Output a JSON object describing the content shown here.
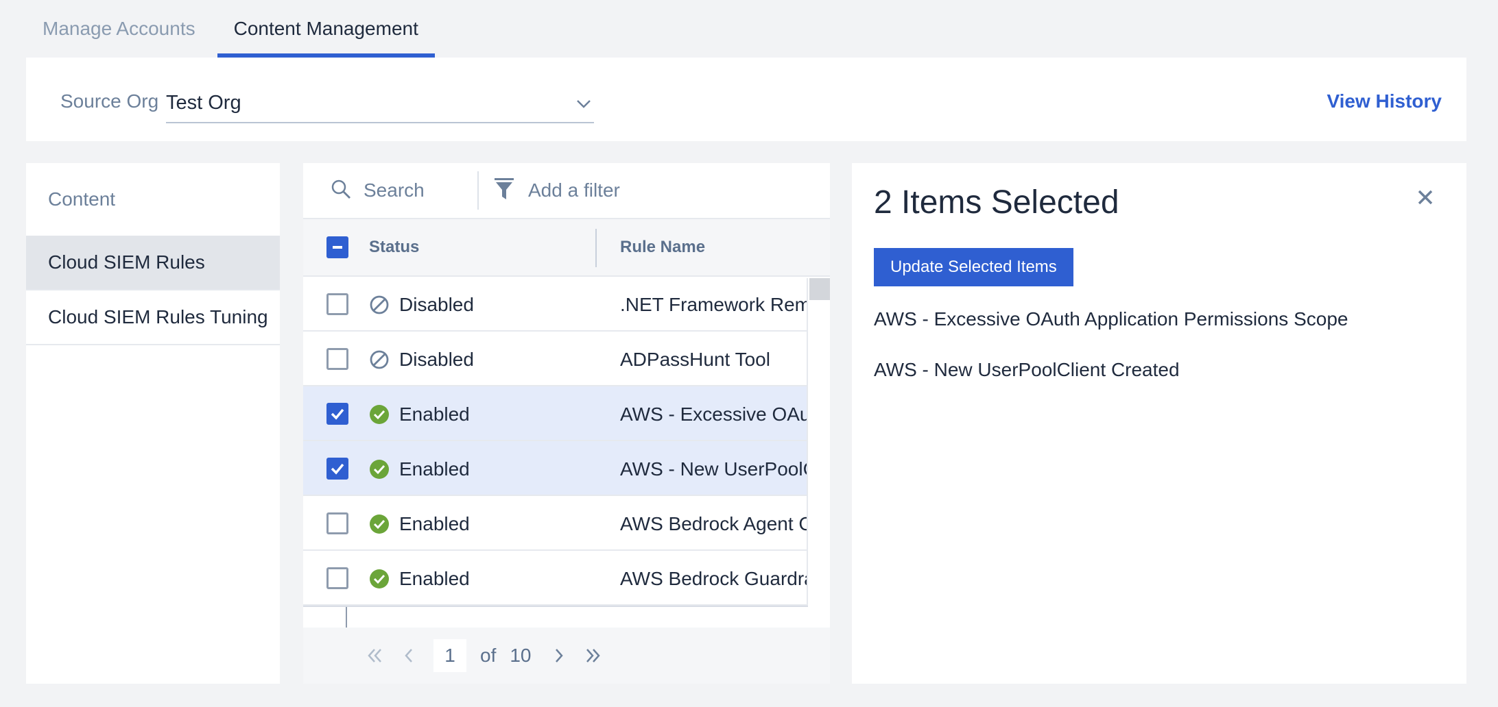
{
  "tabs": [
    {
      "label": "Manage Accounts",
      "active": false
    },
    {
      "label": "Content Management",
      "active": true
    }
  ],
  "org_bar": {
    "label": "Source Org",
    "value": "Test Org",
    "view_history": "View History"
  },
  "left_nav": {
    "heading": "Content",
    "items": [
      {
        "label": "Cloud SIEM Rules",
        "active": true
      },
      {
        "label": "Cloud SIEM Rules Tuning",
        "active": false
      }
    ]
  },
  "table": {
    "search_placeholder": "Search",
    "filter_label": "Add a filter",
    "columns": {
      "status": "Status",
      "name": "Rule Name"
    },
    "rows": [
      {
        "status": "Disabled",
        "name": ".NET Framework Remote",
        "checked": false,
        "icon": "disabled-icon"
      },
      {
        "status": "Disabled",
        "name": "ADPassHunt Tool",
        "checked": false,
        "icon": "disabled-icon"
      },
      {
        "status": "Enabled",
        "name": "AWS - Excessive OAuth",
        "checked": true,
        "icon": "enabled-check-icon"
      },
      {
        "status": "Enabled",
        "name": "AWS - New UserPoolClient",
        "checked": true,
        "icon": "enabled-check-icon"
      },
      {
        "status": "Enabled",
        "name": "AWS Bedrock Agent C",
        "checked": false,
        "icon": "enabled-check-icon"
      },
      {
        "status": "Enabled",
        "name": "AWS Bedrock Guardrail",
        "checked": false,
        "icon": "enabled-check-icon"
      }
    ],
    "pagination": {
      "current": "1",
      "of_label": "of",
      "total": "10"
    }
  },
  "selection": {
    "title": "2 Items Selected",
    "update_button": "Update Selected Items",
    "items": [
      "AWS - Excessive OAuth Application Permissions Scope",
      "AWS - New UserPoolClient Created"
    ]
  },
  "colors": {
    "accent": "#2f5fd1",
    "enabled_green": "#6ba539",
    "selected_row": "#e4ebfa"
  }
}
